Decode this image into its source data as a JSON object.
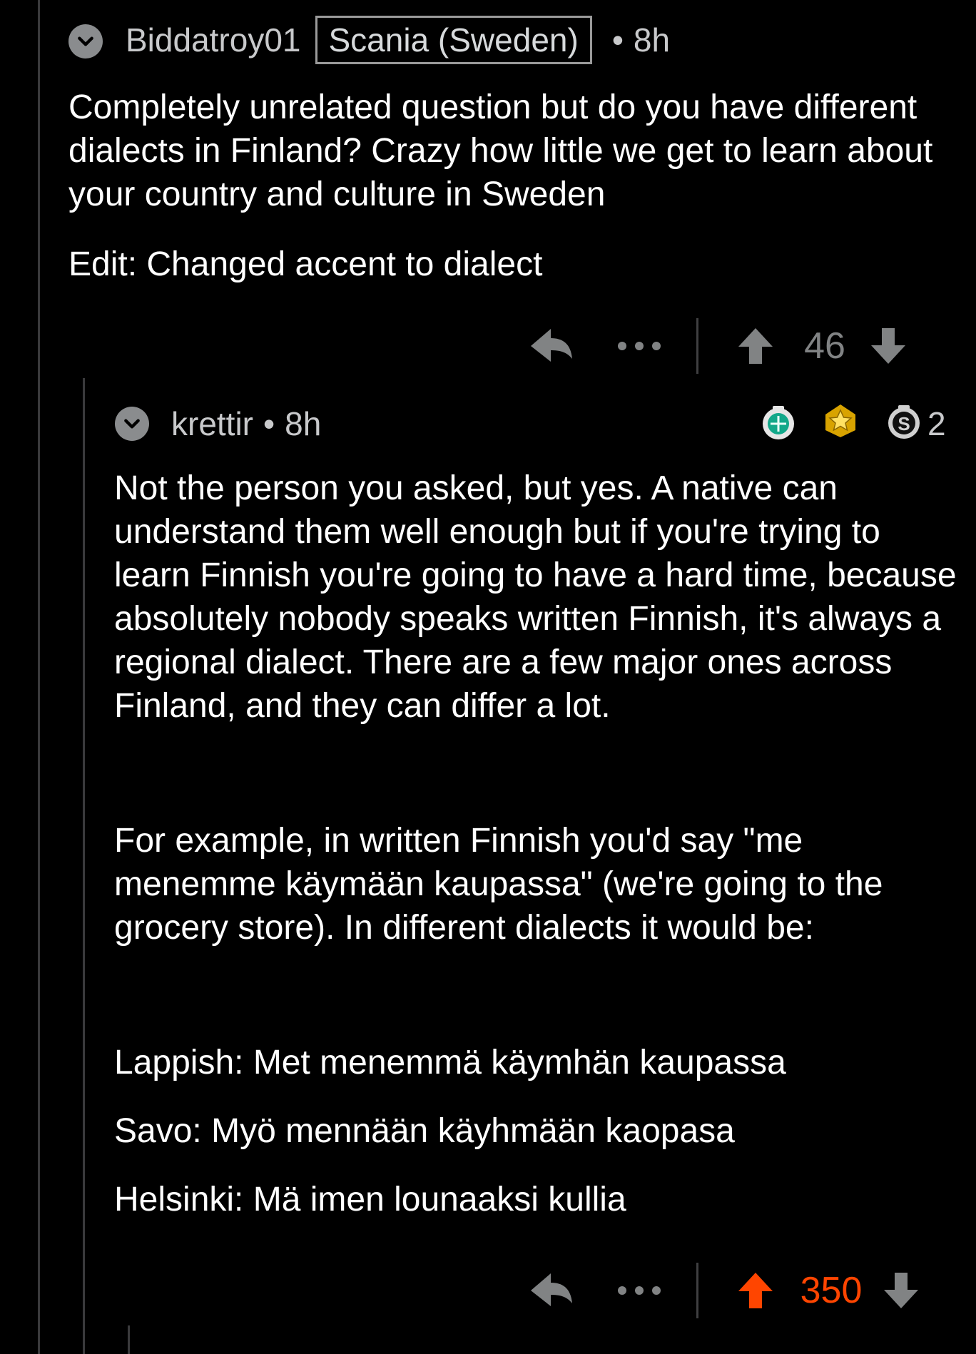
{
  "comment1": {
    "author": "Biddatroy01",
    "flair": "Scania (Sweden)",
    "separator": "•",
    "age": "8h",
    "body": "Completely unrelated question but do you have different dialects in Finland? Crazy how little we get to learn about your country and culture in Sweden",
    "edit": "Edit: Changed accent to dialect",
    "score": "46",
    "vote_state": "none"
  },
  "comment2": {
    "author": "krettir",
    "separator": "•",
    "age": "8h",
    "awards": [
      {
        "icon": "helpful-award-icon"
      },
      {
        "icon": "wholesome-award-icon"
      },
      {
        "icon": "silver-award-icon"
      }
    ],
    "award_count": "2",
    "para1": "Not the person you asked, but yes. A native can understand them well enough but if you're trying to learn Finnish you're going to have a hard time, because absolutely nobody speaks written Finnish, it's always a regional dialect. There are a few major ones across Finland, and they can differ a lot.",
    "para2": "For example, in written Finnish you'd say \"me menemme käymään kaupassa\" (we're going to the grocery store). In different dialects it would be:",
    "line_lappish": "Lappish: Met menemmä käymhän kaupassa",
    "line_savo": "Savo: Myö mennään käyhmään kaopasa",
    "line_helsinki": "Helsinki: Mä imen lounaaksi kullia",
    "score": "350",
    "vote_state": "upvoted"
  },
  "colors": {
    "background": "#000000",
    "text": "#ffffff",
    "meta": "#c8c9cb",
    "upvote_active": "#ff4500",
    "icon_gray": "#8a8c8e"
  }
}
